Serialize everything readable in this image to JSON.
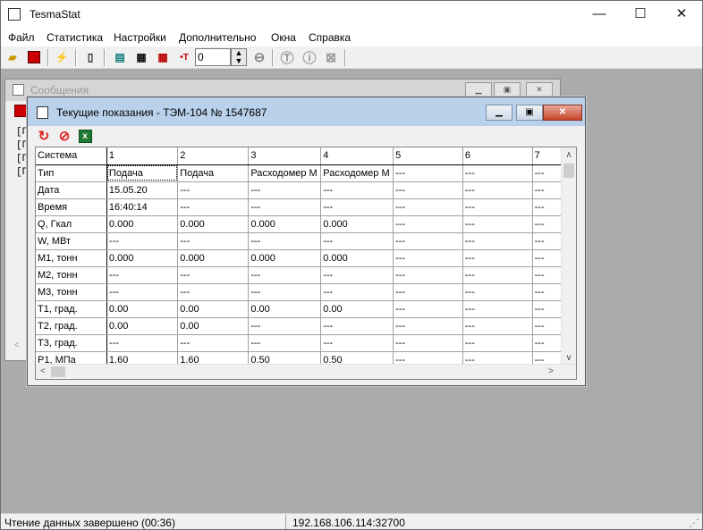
{
  "app": {
    "title": "TesmaStat",
    "minimize": "—",
    "maximize": "☐",
    "close": "✕"
  },
  "menu": [
    "Файл",
    "Статистика",
    "Настройки",
    "Дополнительно",
    "Окна",
    "Справка"
  ],
  "toolbar": {
    "spin_value": "0",
    "icons": [
      "open-icon",
      "save-icon",
      "connect-icon",
      "device-icon",
      "calendar-icon",
      "table-icon",
      "table-red-icon",
      "time-set-icon",
      "stop-icon",
      "t-icon",
      "info-icon",
      "excel-icon"
    ]
  },
  "messages_window": {
    "title": "Сообщения",
    "lines": [
      "[П",
      "[П",
      "[П",
      "[П"
    ]
  },
  "readings_window": {
    "title": "Текущие показания - ТЭМ-104 № 1547687",
    "columns": [
      "Система",
      "1",
      "2",
      "3",
      "4",
      "5",
      "6",
      "7"
    ],
    "rows": [
      [
        "Тип",
        "Подача",
        "Подача",
        "Расходомер М",
        "Расходомер М",
        "---",
        "---",
        "---"
      ],
      [
        "Дата",
        "15.05.20",
        "---",
        "---",
        "---",
        "---",
        "---",
        "---"
      ],
      [
        "Время",
        "16:40:14",
        "---",
        "---",
        "---",
        "---",
        "---",
        "---"
      ],
      [
        "Q, Гкал",
        "0.000",
        "0.000",
        "0.000",
        "0.000",
        "---",
        "---",
        "---"
      ],
      [
        "W, МВт",
        "---",
        "---",
        "---",
        "---",
        "---",
        "---",
        "---"
      ],
      [
        "М1, тонн",
        "0.000",
        "0.000",
        "0.000",
        "0.000",
        "---",
        "---",
        "---"
      ],
      [
        "М2, тонн",
        "---",
        "---",
        "---",
        "---",
        "---",
        "---",
        "---"
      ],
      [
        "М3, тонн",
        "---",
        "---",
        "---",
        "---",
        "---",
        "---",
        "---"
      ],
      [
        "Т1, град.",
        "0.00",
        "0.00",
        "0.00",
        "0.00",
        "---",
        "---",
        "---"
      ],
      [
        "Т2, град.",
        "0.00",
        "0.00",
        "---",
        "---",
        "---",
        "---",
        "---"
      ],
      [
        "Т3, град.",
        "---",
        "---",
        "---",
        "---",
        "---",
        "---",
        "---"
      ],
      [
        "Р1, МПа",
        "1.60",
        "1.60",
        "0.50",
        "0.50",
        "---",
        "---",
        "---"
      ]
    ]
  },
  "status": {
    "message": "Чтение данных завершено (00:36)",
    "address": "192.168.106.114:32700"
  }
}
